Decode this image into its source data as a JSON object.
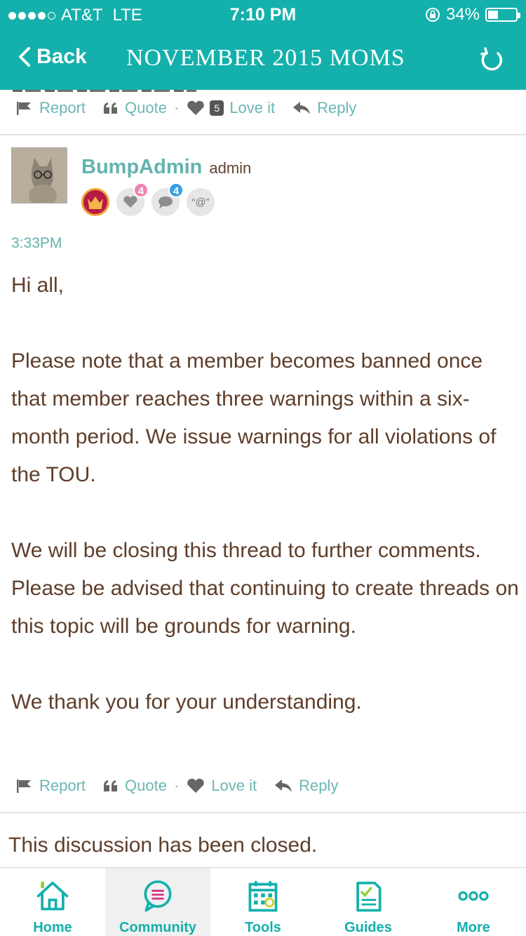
{
  "status_bar": {
    "carrier": "AT&T",
    "network": "LTE",
    "time": "7:10 PM",
    "battery": "34%",
    "battery_level": 0.34
  },
  "nav": {
    "back_label": "Back",
    "title": "NOVEMBER 2015 MOMS"
  },
  "prev_post_actions": {
    "report": "Report",
    "quote": "Quote",
    "love_count": "5",
    "love": "Love it",
    "reply": "Reply"
  },
  "post": {
    "author": "BumpAdmin",
    "role": "admin",
    "badges": {
      "likes_count": "4",
      "comments_count": "4",
      "mention": "“@”"
    },
    "time": "3:33PM",
    "paragraphs": [
      "Hi all,",
      "Please note that a member becomes banned once that member reaches three warnings within a six-month period. We issue warnings for all violations of the TOU.",
      "We will be closing this thread to further comments. Please be advised that continuing to create threads on this topic will be grounds for warning.",
      "We thank you for your understanding."
    ],
    "actions": {
      "report": "Report",
      "quote": "Quote",
      "love": "Love it",
      "reply": "Reply"
    }
  },
  "closed_notice": "This discussion has been closed.",
  "tabbar": {
    "home": "Home",
    "community": "Community",
    "tools": "Tools",
    "guides": "Guides",
    "more": "More",
    "active": "community"
  },
  "colors": {
    "teal": "#14b0ac",
    "brown_text": "#5f3e2a",
    "link": "#6ab7b3"
  }
}
